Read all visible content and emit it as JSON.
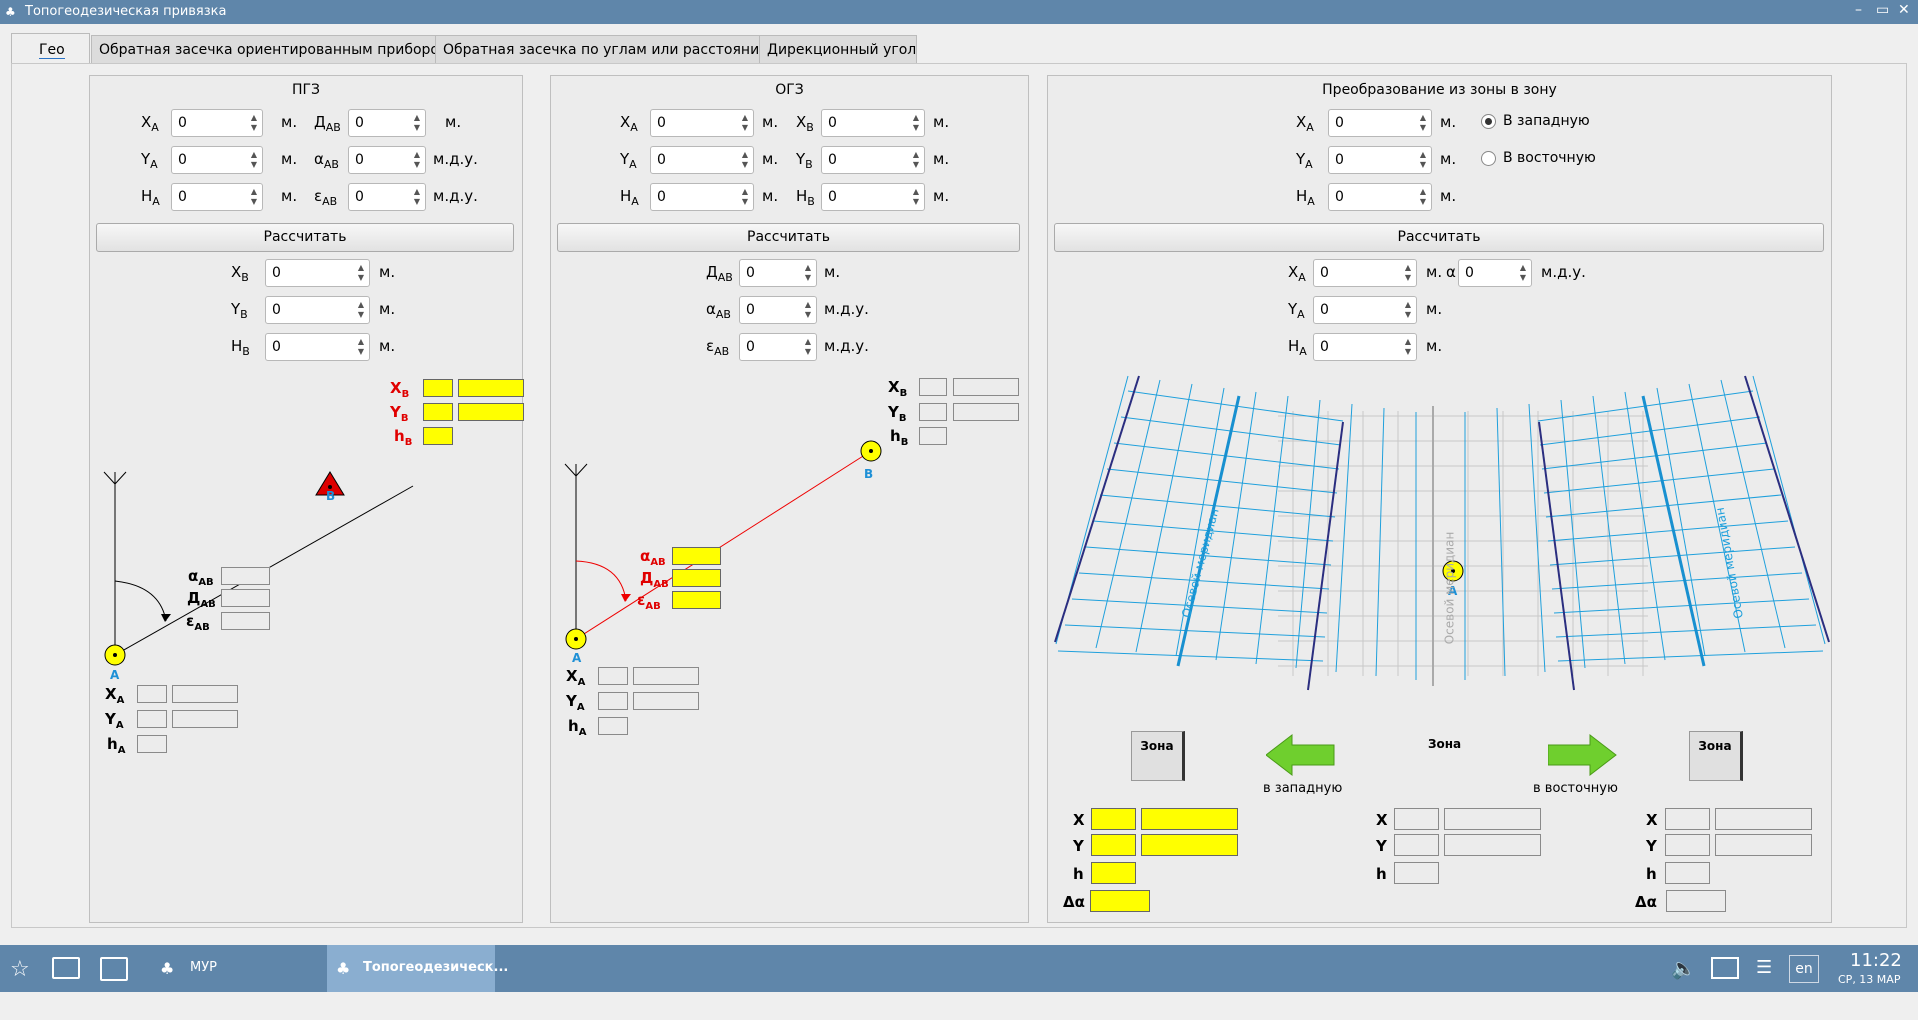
{
  "window": {
    "title": "Топогеодезическая привязка",
    "minimize": "–",
    "maximize": "▭",
    "close": "✕"
  },
  "tabs": [
    "Гео",
    "Обратная засечка ориентированным прибором",
    "Обратная засечка по углам или расстояниям",
    "Дирекционный угол"
  ],
  "units": {
    "m": "м.",
    "mdu": "м.д.у."
  },
  "calc": "Рассчитать",
  "letters": {
    "X": "X",
    "Y": "Y",
    "H": "H",
    "h": "h",
    "D": "Д",
    "alpha": "α",
    "eps": "ε",
    "A": "A",
    "B": "B",
    "AB": "AB",
    "dalpha": "Δα",
    "X_plain": "X",
    "Y_plain": "Y",
    "h_plain": "h"
  },
  "pgz": {
    "title": "ПГЗ",
    "xa": "0",
    "da": "0",
    "ya": "0",
    "aa": "0",
    "ha": "0",
    "ea": "0",
    "xb": "0",
    "yb": "0",
    "hb": "0"
  },
  "ogz": {
    "title": "ОГЗ",
    "xa": "0",
    "xb": "0",
    "ya": "0",
    "yb": "0",
    "ha": "0",
    "hb": "0",
    "d": "0",
    "a": "0",
    "e": "0"
  },
  "zone": {
    "title": "Преобразование из зоны в зону",
    "xa": "0",
    "ya": "0",
    "ha": "0",
    "west": "В западную",
    "east": "В восточную",
    "out_xa": "0",
    "out_alpha": "0",
    "out_ya": "0",
    "out_ha": "0",
    "meridian": "Осевой меридиан",
    "zone_label": "Зона",
    "to_west": "в западную",
    "to_east": "в восточную"
  },
  "taskbar": {
    "app1": "МУР",
    "app2": "Топогеодезическ...",
    "lang": "en",
    "time": "11:22",
    "date": "СР, 13 МАР"
  }
}
